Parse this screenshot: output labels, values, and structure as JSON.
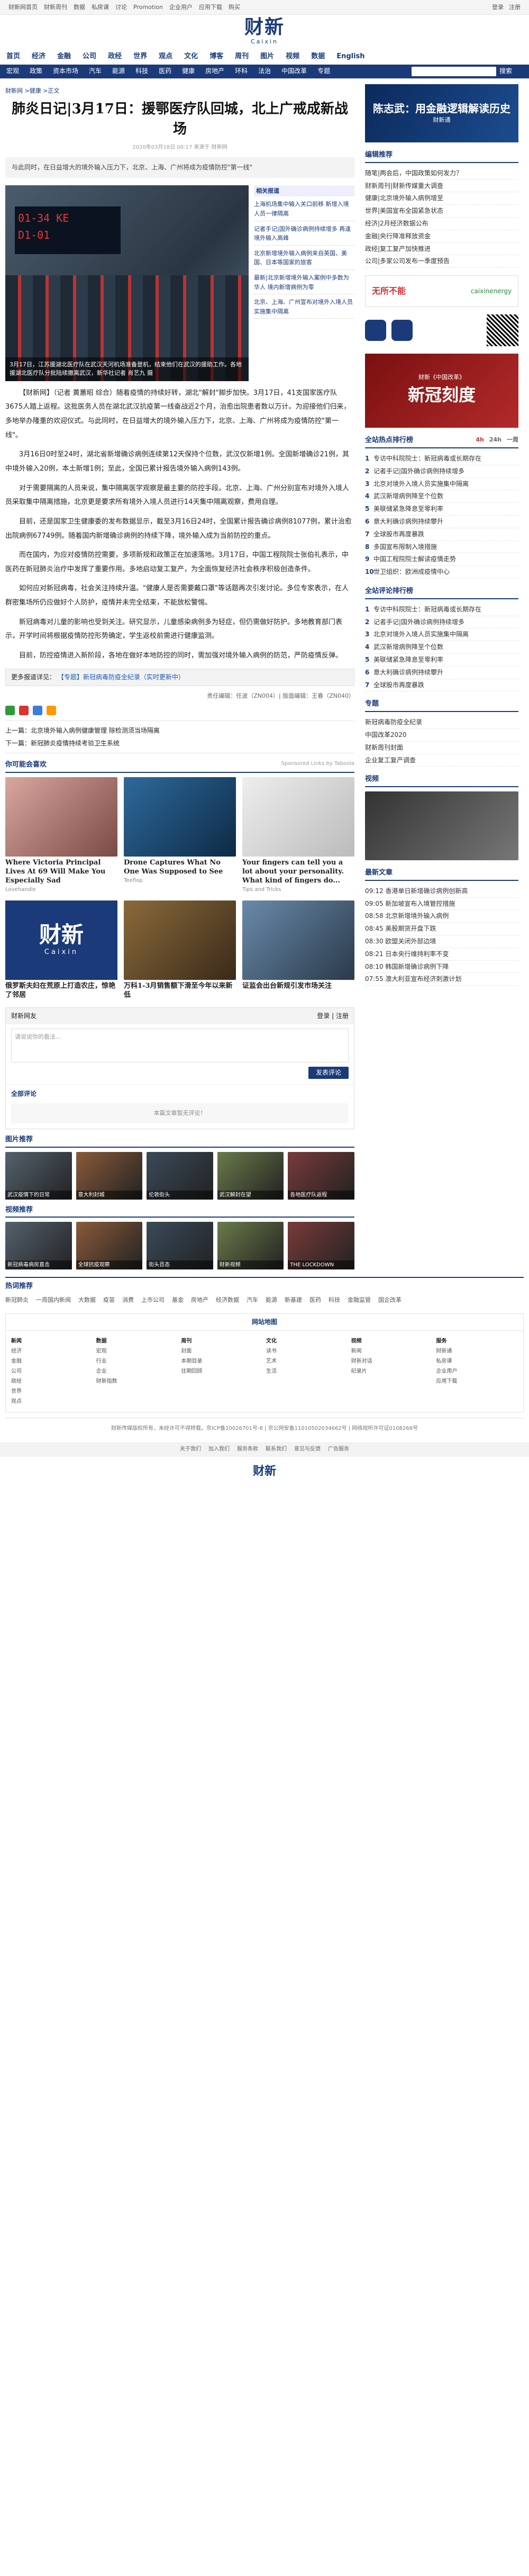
{
  "topbar": {
    "links": [
      "财新网首页",
      "财新周刊",
      "数据",
      "私房课",
      "讨论",
      "Promotion",
      "企业用户",
      "应用下载",
      "购买"
    ],
    "login": "登录",
    "register": "注册"
  },
  "logo": {
    "cn": "财新",
    "en": "Caixin"
  },
  "nav": {
    "primary": [
      "首页",
      "经济",
      "金融",
      "公司",
      "政经",
      "世界",
      "观点",
      "文化",
      "博客",
      "周刊",
      "图片",
      "视频",
      "数据",
      "English"
    ],
    "secondary": [
      "宏观",
      "政策",
      "资本市场",
      "汽车",
      "能源",
      "科技",
      "医药",
      "健康",
      "房地产",
      "环科",
      "法治",
      "中国改革",
      "专题"
    ],
    "search_label": "搜索"
  },
  "article": {
    "breadcrumb": "财新网 >健康 >正文",
    "title": "肺炎日记|3月17日：援鄂医疗队回城，北上广戒成新战场",
    "meta": "2020年03月18日 00:17  来源于 财新网",
    "summary": "与此同时，在日益增大的境外输入压力下，北京、上海、广州将成为疫情防控\"第一线\"",
    "photo_board": "01-34 KE\nD1-01",
    "photo_caption": "3月17日，江苏援湖北医疗队在武汉天河机场准备登机，结束他们在武汉的援助工作。各地援湖北医疗队分批陆续撤离武汉，新华社记者 肖艺九 摄",
    "related_label": "相关报道",
    "related": [
      "上海机场集中输入关口前移 新增入境人员一律隔离",
      "记者手记|国外确诊病例持续增多 再逢境外输入高峰",
      "北京新增境外输入病例来自英国、美国、日本等国家的旅客",
      "最新|北京新增境外输入案例中多数为华人 境内新增病例为零",
      "北京、上海、广州宣布对境外入境人员实施集中隔离"
    ],
    "paragraphs": [
      "【财新网】（记者 黄蕙昭 综合）随着疫情的持续好转，湖北\"解封\"脚步加快。3月17日，41支国家医疗队3675人踏上返程。这批医务人员在湖北武汉抗疫第一线奋战近2个月，治愈出院患者数以万计。为迎接他们归来，多地举办隆重的欢迎仪式。与此同时，在日益增大的境外输入压力下，北京、上海、广州将成为疫情防控\"第一线\"。",
      "3月16日0时至24时，湖北省新增确诊病例连续第12天保持个位数，武汉仅新增1例。全国新增确诊21例，其中境外输入20例，本土新增1例；至此，全国已累计报告境外输入病例143例。",
      "对于需要隔离的人员来说，集中隔离医学观察是最主要的防控手段。北京、上海、广州分别宣布对境外入境人员采取集中隔离措施，北京更是要求所有境外入境人员进行14天集中隔离观察，费用自理。",
      "目前，还是国家卫生健康委的发布数据显示，截至3月16日24时，全国累计报告确诊病例81077例，累计治愈出院病例67749例。随着国内新增确诊病例的持续下降，境外输入成为当前防控的重点。",
      "而在国内，为应对疫情防控需要，多项新规和政策正在加速落地。3月17日，中国工程院院士张伯礼表示，中医药在新冠肺炎治疗中发挥了重要作用。多地启动复工复产，为全面恢复经济社会秩序积极创造条件。",
      "如何应对新冠病毒，社会关注持续升温。\"健康人是否需要戴口罩\"等话题再次引发讨论。多位专家表示，在人群密集场所仍应做好个人防护，疫情并未完全结束，不能放松警惕。",
      "新冠病毒对儿童的影响也受到关注。研究显示，儿童感染病例多为轻症，但仍需做好防护。多地教育部门表示，开学时间将根据疫情防控形势确定，学生返校前需进行健康监测。",
      "目前，防控疫情进入新阶段，各地在做好本地防控的同时，需加强对境外输入病例的防范，严防疫情反弹。"
    ],
    "more_label": "更多报道详见：",
    "more_link": "【专题】新冠病毒防疫全纪录（实时更新中）",
    "editor": "责任编辑：任波（ZN004）| 版面编辑：王春（ZN040）",
    "prev": "上一篇：北京境外输入病例健康管理 除检测须当场隔离",
    "next": "下一篇：新冠肺炎疫情持续考验卫生系统"
  },
  "recommend": {
    "title": "你可能会喜欢",
    "sponsor": "Sponsored Links by Taboola",
    "cards": [
      {
        "title": "Where Victoria Principal Lives At 69 Will Make You Especially Sad",
        "source": "Lovehandle"
      },
      {
        "title": "Drone Captures What No One Was Supposed to See",
        "source": "Teeflop"
      },
      {
        "title": "Your fingers can tell you a lot about your personality. What kind of fingers do...",
        "source": "Tips and Tricks"
      },
      {
        "title": "俄罗斯夫妇在荒原上打造农庄，惊艳了邻居",
        "source": ""
      },
      {
        "title": "万科1-3月销售额下滑至今年以来新低",
        "source": ""
      },
      {
        "title": "证监会出台新规引发市场关注",
        "source": ""
      }
    ]
  },
  "comments": {
    "title": "财新网友",
    "login": "登录",
    "register": "注册",
    "placeholder": "请说说你的看法...",
    "submit": "发表评论",
    "tab": "全部评论",
    "empty": "本篇文章暂无评论！"
  },
  "sections": {
    "photos": "图片推荐",
    "videos": "视频推荐",
    "hotwords": "热词推荐"
  },
  "photo_strip": [
    "武汉疫情下的日常",
    "意大利封城",
    "伦敦街头",
    "武汉解封在望",
    "各地医疗队返程"
  ],
  "video_strip": [
    "新冠病毒病房直击",
    "全球抗疫观察",
    "街头百态",
    "财新视频",
    "THE LOCKDOWN"
  ],
  "hotwords": [
    "新冠肺炎",
    "一周国内新闻",
    "大数据",
    "疫苗",
    "消费",
    "上市公司",
    "基金",
    "房地产",
    "经济数据",
    "汽车",
    "能源",
    "新基建",
    "医药",
    "科技",
    "金融监管",
    "国企改革"
  ],
  "sitemap": {
    "title": "网站地图",
    "cols": [
      {
        "head": "新闻",
        "items": [
          "经济",
          "金融",
          "公司",
          "政经",
          "世界",
          "观点"
        ]
      },
      {
        "head": "数据",
        "items": [
          "宏观",
          "行业",
          "企业",
          "财新指数"
        ]
      },
      {
        "head": "周刊",
        "items": [
          "封面",
          "本期目录",
          "往期回顾"
        ]
      },
      {
        "head": "文化",
        "items": [
          "读书",
          "艺术",
          "生活"
        ]
      },
      {
        "head": "视频",
        "items": [
          "新闻",
          "财新对话",
          "纪录片"
        ]
      },
      {
        "head": "服务",
        "items": [
          "财新通",
          "私房课",
          "企业用户",
          "应用下载"
        ]
      }
    ]
  },
  "footer": {
    "text": "财新传媒版权所有，未经许可不得转载。京ICP备10026701号-8 | 京公网安备11010502034662号 | 网络视听许可证0108268号",
    "links": [
      "关于我们",
      "加入我们",
      "服务条款",
      "联系我们",
      "意见与反馈",
      "广告服务"
    ],
    "logo": "财新"
  },
  "sidebar": {
    "ad1": {
      "title": "陈志武：用金融逻辑解读历史",
      "sub": "财新通"
    },
    "top_news_title": "编辑推荐",
    "top_news": [
      "随笔|两会后，中国政策如何发力？",
      "财新周刊|财新传媒重大调查",
      "健康|北京境外输入病例增至",
      "世界|美国宣布全国紧急状态",
      "经济|2月经济数据公布",
      "金融|央行降准释放资金",
      "政经|复工复产加快推进",
      "公司|多家公司发布一季度预告"
    ],
    "ad2": {
      "title": "无所不能",
      "sub": "caixinenergy"
    },
    "ad3": {
      "title": "新冠刻度",
      "sub": "财新《中国改革》"
    },
    "hot_title": "全站热点排行榜",
    "hot_tabs": [
      "4h",
      "24h",
      "一周"
    ],
    "hot": [
      "专访中科院院士：新冠病毒或长期存在",
      "记者手记|国外确诊病例持续增多",
      "北京对境外入境人员实施集中隔离",
      "武汉新增病例降至个位数",
      "美联储紧急降息至零利率",
      "意大利确诊病例持续攀升",
      "全球股市再度暴跌",
      "多国宣布限制入境措施",
      "中国工程院院士解读疫情走势",
      "世卫组织：欧洲成疫情中心"
    ],
    "week_title": "全站评论排行榜",
    "week": [
      "专访中科院院士：新冠病毒或长期存在",
      "记者手记|国外确诊病例持续增多",
      "北京对境外入境人员实施集中隔离",
      "武汉新增病例降至个位数",
      "美联储紧急降息至零利率",
      "意大利确诊病例持续攀升",
      "全球股市再度暴跌"
    ],
    "subject_title": "专题",
    "subjects": [
      "新冠病毒防疫全纪录",
      "中国改革2020",
      "财新周刊封面",
      "企业复工复产调查"
    ],
    "video_title": "视频",
    "latest_title": "最新文章",
    "latest": [
      "09:12 香港单日新增确诊病例创新高",
      "09:05 新加坡宣布入境管控措施",
      "08:58 北京新增境外输入病例",
      "08:45 美股期货开盘下跌",
      "08:30 欧盟关闭外部边境",
      "08:21 日本央行维持利率不变",
      "08:10 韩国新增确诊病例下降",
      "07:55 澳大利亚宣布经济刺激计划"
    ]
  }
}
